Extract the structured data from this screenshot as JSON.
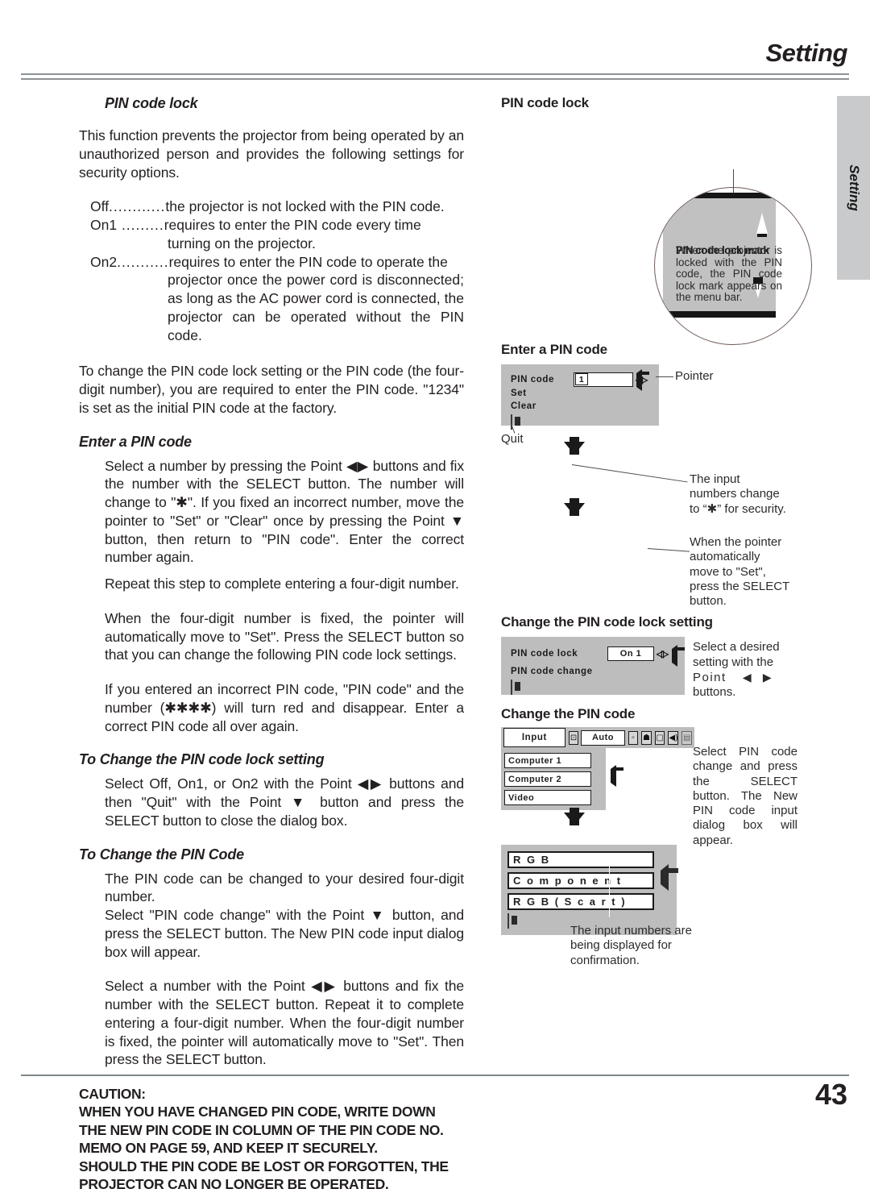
{
  "header": {
    "title": "Setting"
  },
  "side_tab": {
    "label": "Setting"
  },
  "footer": {
    "page_number": "43"
  },
  "left": {
    "heading": "PIN code lock",
    "intro": "This function prevents the projector from being operated by an unauthorized person and provides the following settings for security options.",
    "definitions": [
      {
        "term": "Off",
        "dots": "............",
        "desc": "the projector is not locked with the PIN code.",
        "continuation": ""
      },
      {
        "term": "On1",
        "dots": " .........",
        "desc": "requires to enter the PIN code every time",
        "continuation": "turning on the projector."
      },
      {
        "term": "On2",
        "dots": "...........",
        "desc": "requires to enter the PIN code to operate the",
        "continuation": "projector once the power cord is disconnected; as long as the AC power cord is connected, the projector can be operated without the PIN code."
      }
    ],
    "change_note": "To change the PIN code lock setting or the PIN code (the four-digit number), you are required to enter the PIN code. \"1234\" is set as the initial PIN code at the factory.",
    "enter_pin_heading": "Enter a PIN code",
    "enter_pin_p1": "Select a number by pressing the Point ◀▶ buttons and fix the number with the SELECT button.  The number will change to \"✱\".  If you fixed an incorrect number, move the pointer to \"Set\" or \"Clear\" once by pressing the Point ▼ button, then return to \"PIN code\".  Enter the correct number again.",
    "enter_pin_p2": "Repeat this step to complete entering a four-digit number.",
    "enter_pin_p3": "When the four-digit number is fixed, the pointer will automatically move to \"Set\".  Press the SELECT button so that you can change the following PIN code lock settings.",
    "enter_pin_p4": "If you entered an incorrect PIN code, \"PIN code\" and the number (✱✱✱✱) will turn red and disappear.  Enter a correct PIN code all over again.",
    "change_lock_heading": "To Change the PIN code lock setting",
    "change_lock_p1": "Select Off, On1, or On2 with the Point ◀▶ buttons and then   \"Quit\" with the Point ▼ button and press the SELECT button to close the dialog box.",
    "change_code_heading": "To Change the PIN Code",
    "change_code_p1": "The PIN code can be changed to your desired four-digit number.",
    "change_code_p2": "Select \"PIN code change\" with the Point ▼ button, and press the SELECT button.  The New PIN code input dialog box will appear.",
    "change_code_p3": "Select a number with the Point ◀▶ buttons and fix the number with the SELECT button. Repeat it to complete entering a four-digit number.  When the four-digit number is fixed, the pointer will automatically move to \"Set\".  Then press the SELECT button.",
    "caution": {
      "title": "CAUTION:",
      "lines": [
        "WHEN YOU HAVE CHANGED PIN CODE, WRITE DOWN",
        "THE NEW PIN CODE IN COLUMN OF THE PIN CODE NO.",
        "MEMO ON PAGE 59, AND KEEP IT SECURELY.",
        "SHOULD THE PIN CODE BE LOST OR FORGOTTEN, THE",
        "PROJECTOR CAN NO LONGER BE OPERATED."
      ]
    }
  },
  "right": {
    "pin_lock_heading": "PIN code lock",
    "magnifier_caption": "When the projector is locked with the PIN code, the PIN code lock mark appears on the menu bar.",
    "magnifier_caption_under": "PIN code lock mark",
    "enter_pin_heading": "Enter a PIN code",
    "enter_pin_dialog": {
      "row1_label": "PIN code",
      "row1_value": "1",
      "row2_label": "Set",
      "row3_label": "Clear",
      "quit_icon_name": "quit-icon"
    },
    "pointer_label": "Pointer",
    "quit_label": "Quit",
    "anno_asterisk": "The input numbers change to “✱” for security.",
    "anno_pointer_set": "When the pointer automatically move to \"Set\", press the SELECT button.",
    "change_lock_heading": "Change the PIN code lock setting",
    "lock_dialog": {
      "row1_label": "PIN code lock",
      "row1_value": "On 1",
      "row2_label": "PIN code change"
    },
    "anno_select_setting": "Select a desired setting with the Point ◀ ▶ buttons.",
    "anno_select_setting_parts": {
      "a": "Select a desired",
      "b": "setting with the",
      "c": "Point",
      "d": "buttons."
    },
    "change_code_heading": "Change the PIN code",
    "input_menu": {
      "tab_label": "Input",
      "auto_label": "Auto",
      "items": [
        "Computer 1",
        "Computer 2",
        "Video"
      ],
      "bar_icons": [
        "input-source-icon",
        "screen-icon",
        "sound-mute-icon",
        "screen-size-icon",
        "volume-icon",
        "lock-icon"
      ]
    },
    "anno_select_pincode_change": "Select PIN code change and press the SELECT button.  The New PIN code input dialog box will appear.",
    "source_menu": {
      "items": [
        "R G B",
        "C o m p o n e n t",
        "R G B ( S c a r t )"
      ]
    },
    "anno_confirmation": "The input numbers are being displayed for confirmation."
  }
}
